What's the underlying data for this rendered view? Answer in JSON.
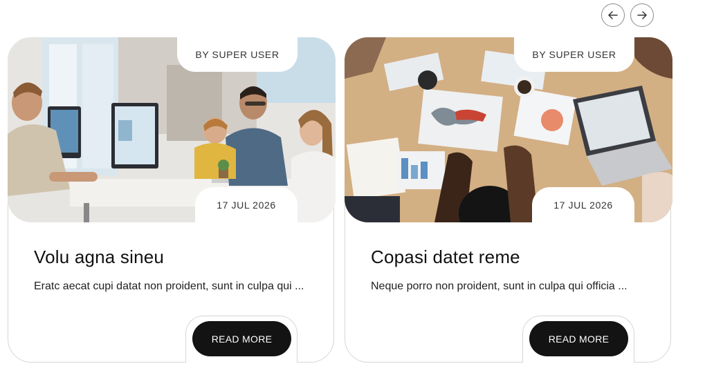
{
  "nav": {
    "prev_icon": "arrow-left-icon",
    "next_icon": "arrow-right-icon"
  },
  "cards": [
    {
      "author": "BY SUPER USER",
      "date": "17 JUL 2026",
      "title": "Volu agna sineu",
      "excerpt": "Eratc aecat cupi datat non proident, sunt in culpa qui ...",
      "button": "READ MORE",
      "image": "office-team-at-computers-photo"
    },
    {
      "author": "BY SUPER USER",
      "date": "17 JUL 2026",
      "title": "Copasi datet reme",
      "excerpt": "Neque porro non proident, sunt in culpa qui officia ...",
      "button": "READ MORE",
      "image": "desk-meeting-with-charts-photo"
    }
  ],
  "colors": {
    "button_bg": "#131313",
    "border": "#d6d6d6"
  }
}
